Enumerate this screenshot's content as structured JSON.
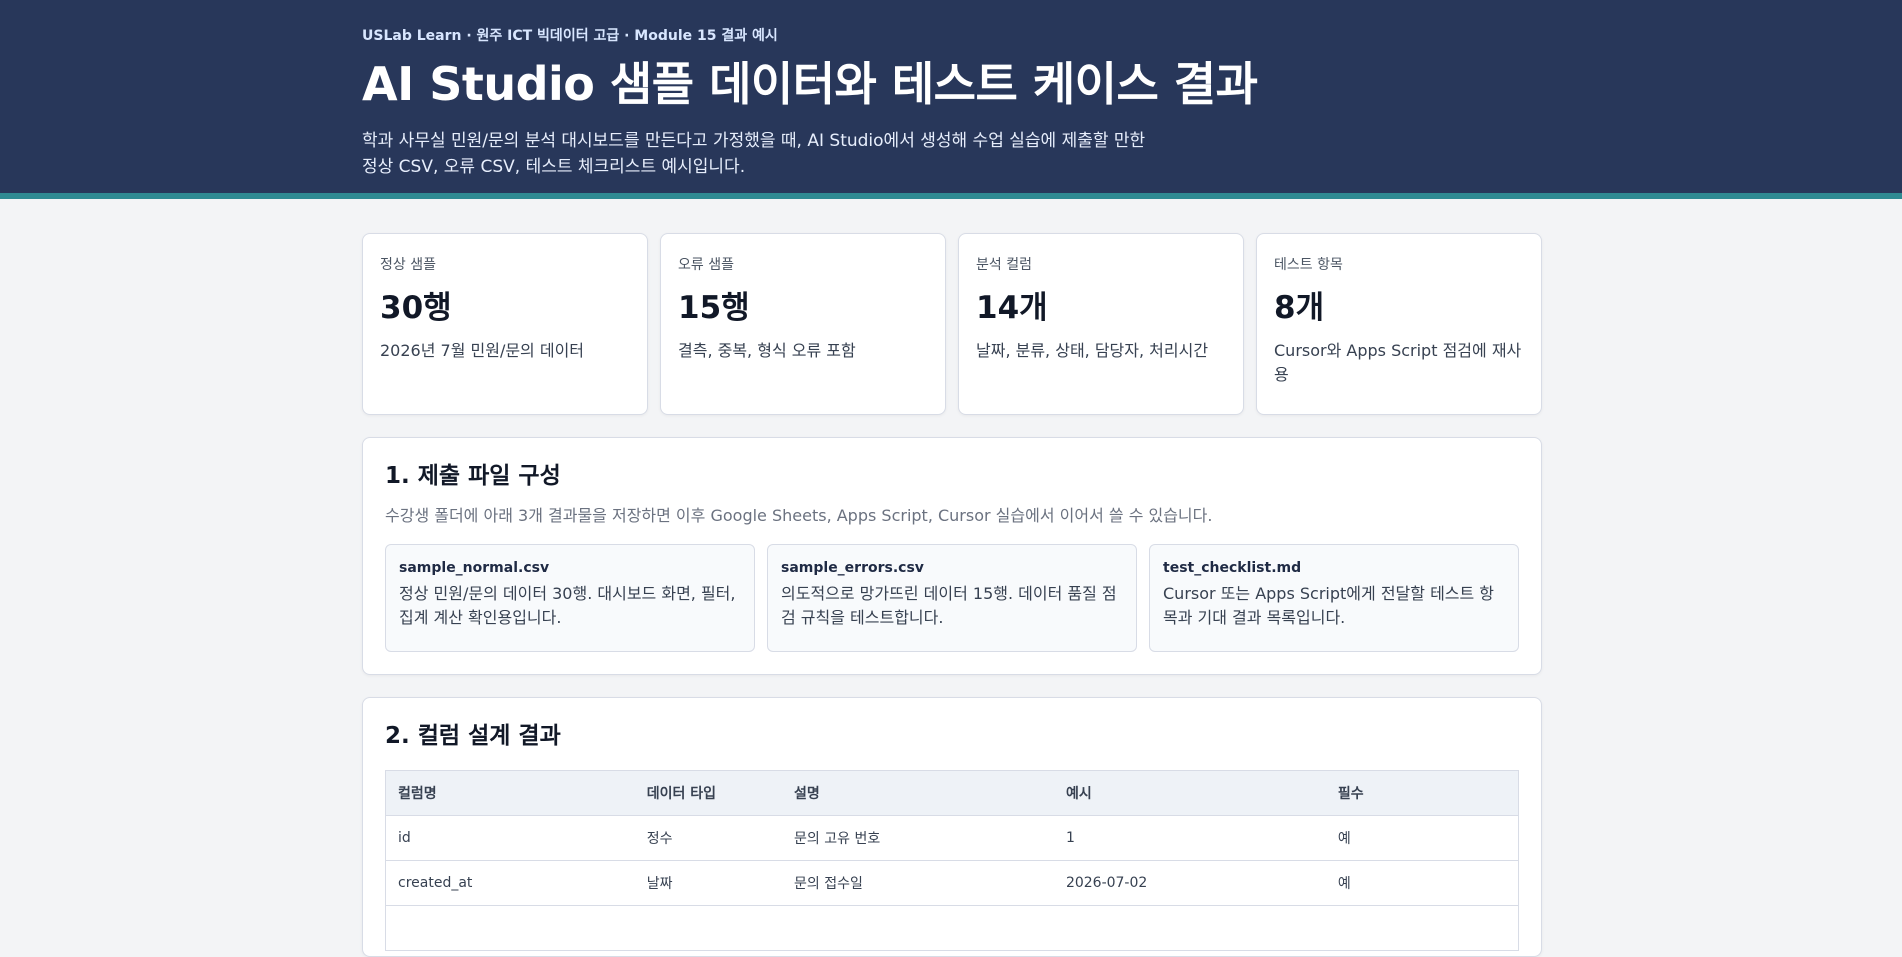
{
  "header": {
    "eyebrow": "USLab Learn · 원주 ICT 빅데이터 고급 · Module 15 결과 예시",
    "title": "AI Studio 샘플 데이터와 테스트 케이스 결과",
    "intro_line1": "학과 사무실 민원/문의 분석 대시보드를 만든다고 가정했을 때, AI Studio에서 생성해 수업 실습에 제출할 만한",
    "intro_line2": "정상 CSV, 오류 CSV, 테스트 체크리스트 예시입니다."
  },
  "colors": {
    "header_bg": "#28375a",
    "accent": "#2f8a92"
  },
  "stats": [
    {
      "label": "정상 샘플",
      "value": "30행",
      "desc": "2026년 7월 민원/문의 데이터"
    },
    {
      "label": "오류 샘플",
      "value": "15행",
      "desc": "결측, 중복, 형식 오류 포함"
    },
    {
      "label": "분석 컬럼",
      "value": "14개",
      "desc": "날짜, 분류, 상태, 담당자, 처리시간"
    },
    {
      "label": "테스트 항목",
      "value": "8개",
      "desc": "Cursor와 Apps Script 점검에 재사용"
    }
  ],
  "section1": {
    "title": "1. 제출 파일 구성",
    "subtitle": "수강생 폴더에 아래 3개 결과물을 저장하면 이후 Google Sheets, Apps Script, Cursor 실습에서 이어서 쓸 수 있습니다.",
    "files": [
      {
        "name": "sample_normal.csv",
        "desc": "정상 민원/문의 데이터 30행. 대시보드 화면, 필터, 집계 계산 확인용입니다."
      },
      {
        "name": "sample_errors.csv",
        "desc": "의도적으로 망가뜨린 데이터 15행. 데이터 품질 점검 규칙을 테스트합니다."
      },
      {
        "name": "test_checklist.md",
        "desc": "Cursor 또는 Apps Script에게 전달할 테스트 항목과 기대 결과 목록입니다."
      }
    ]
  },
  "section2": {
    "title": "2. 컬럼 설계 결과",
    "columns": [
      "컬럼명",
      "데이터 타입",
      "설명",
      "예시",
      "필수"
    ],
    "rows": [
      [
        "id",
        "정수",
        "문의 고유 번호",
        "1",
        "예"
      ],
      [
        "created_at",
        "날짜",
        "문의 접수일",
        "2026-07-02",
        "예"
      ]
    ]
  }
}
